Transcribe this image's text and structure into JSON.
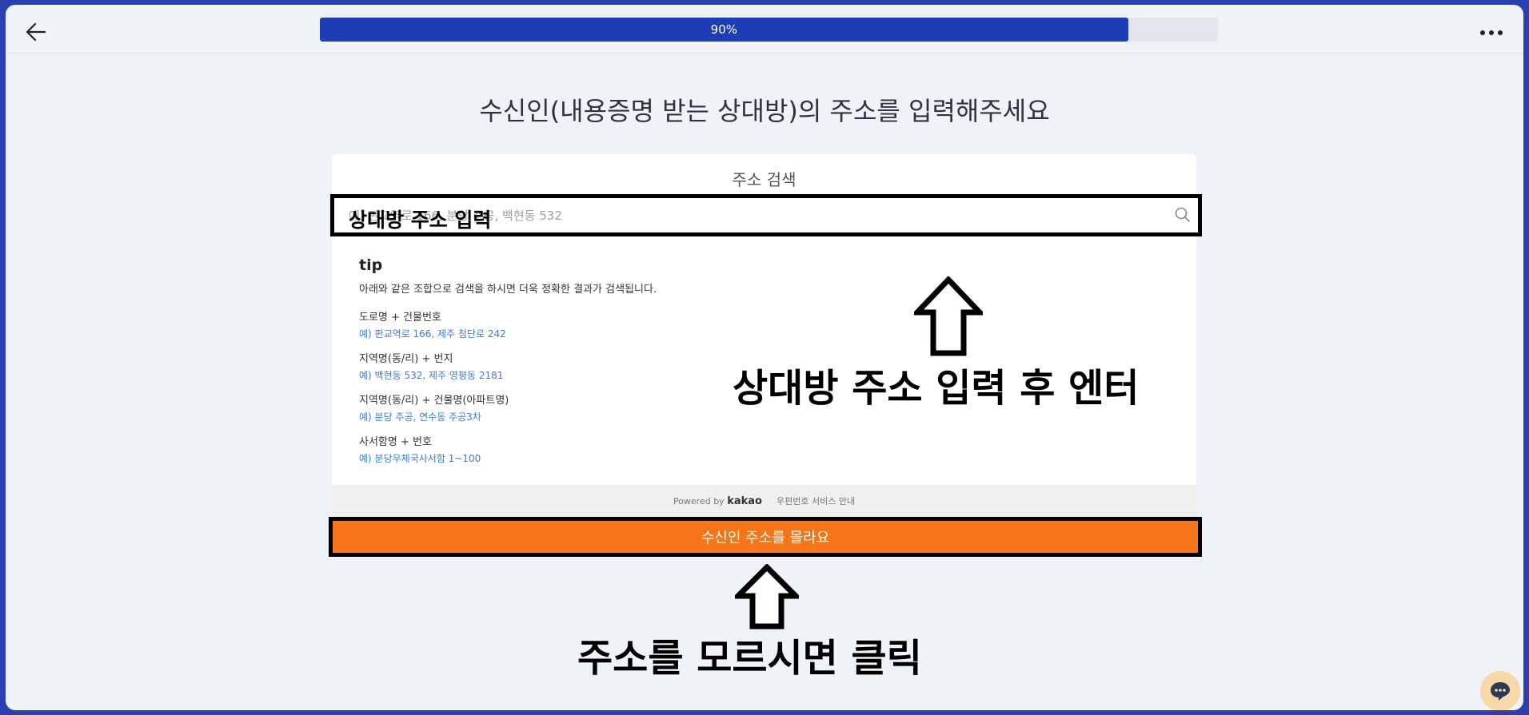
{
  "header": {
    "back_icon": "arrow-left-icon",
    "progress": {
      "value": 0.9,
      "label": "90%",
      "fill_color": "#1e3cb4"
    },
    "more_icon": "ellipsis-icon"
  },
  "page": {
    "title": "수신인(내용증명 받는 상대방)의 주소를 입력해주세요"
  },
  "address_search": {
    "title": "주소 검색",
    "placeholder": "예) 판교역로 166, 분당 주공, 백현동 532",
    "overlay_label": "상대방 주소 입력",
    "tips": {
      "heading": "tip",
      "description": "아래와 같은 조합으로 검색을 하시면 더욱 정확한 결과가 검색됩니다.",
      "items": [
        {
          "label": "도로명 + 건물번호",
          "example": "예) 판교역로 166,  제주 첨단로 242"
        },
        {
          "label": "지역명(동/리) + 번지",
          "example": "예) 백현동 532,  제주 영평동 2181"
        },
        {
          "label": "지역명(동/리) + 건물명(아파트명)",
          "example": "예) 분당 주공,  연수동 주공3차"
        },
        {
          "label": "사서함명 + 번호",
          "example": "예) 분당우체국사서함 1~100"
        }
      ]
    },
    "footer": {
      "powered_by": "Powered by",
      "brand": "kakao",
      "link": "우편번호 서비스 안내"
    }
  },
  "unknown_address_button": "수신인 주소를 몰라요",
  "annotations": {
    "enter_hint": "상대방 주소 입력 후 엔터",
    "click_hint": "주소를 모르시면 클릭"
  },
  "chat": {
    "icon": "chat-bubble-icon",
    "color": "#f7d8a6"
  }
}
